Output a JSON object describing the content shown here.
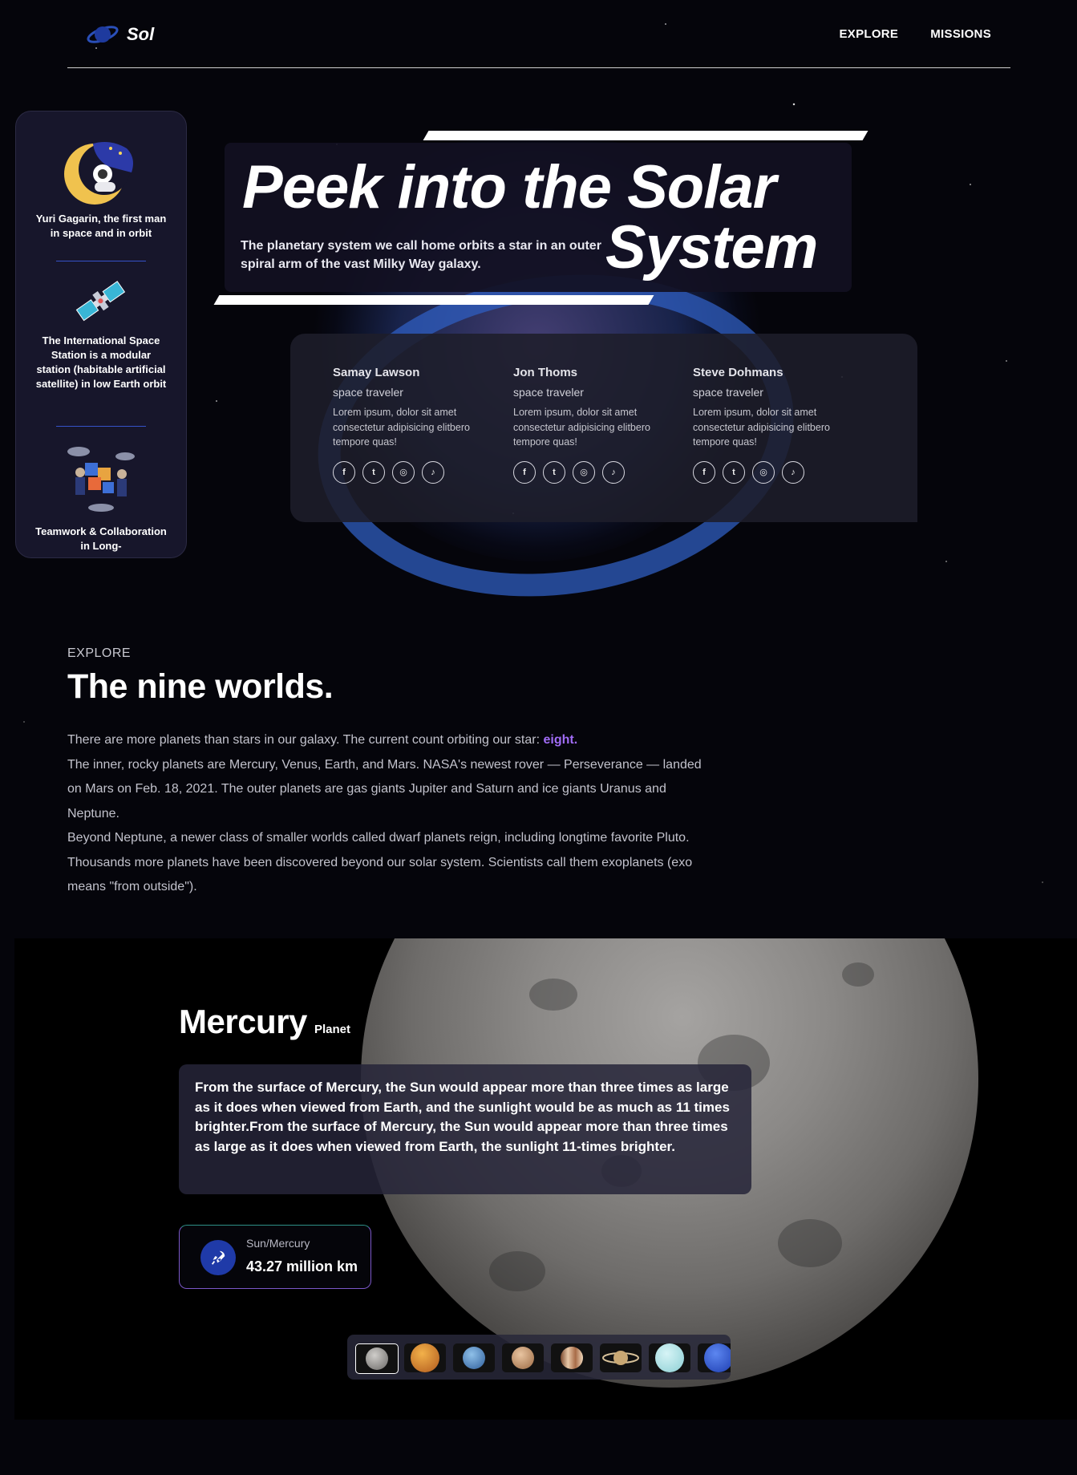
{
  "brand": {
    "name": "Sol"
  },
  "nav": {
    "links": [
      "EXPLORE",
      "MISSIONS"
    ]
  },
  "sidebar": {
    "items": [
      {
        "caption": "Yuri Gagarin, the first man in space and in orbit",
        "icon": "astronaut-moon-icon"
      },
      {
        "caption": "The International Space Station is a modular station (habitable artificial satellite) in low Earth orbit",
        "icon": "satellite-icon"
      },
      {
        "caption": "Teamwork & Collaboration in Long-",
        "icon": "teamwork-icon"
      }
    ]
  },
  "hero": {
    "title_line1": "Peek into the Solar",
    "title_line2": "System",
    "subtitle": "The planetary system we call home orbits a star in an outer spiral arm of the vast Milky Way galaxy."
  },
  "team": [
    {
      "name": "Samay Lawson",
      "role": "space traveler",
      "desc": "Lorem ipsum, dolor sit amet consectetur adipisicing elitbero tempore quas!"
    },
    {
      "name": "Jon Thoms",
      "role": "space traveler",
      "desc": "Lorem ipsum, dolor sit amet consectetur adipisicing elitbero tempore quas!"
    },
    {
      "name": "Steve Dohmans",
      "role": "space traveler",
      "desc": "Lorem ipsum, dolor sit amet consectetur adipisicing elitbero tempore quas!"
    }
  ],
  "social_icons": [
    "facebook-icon",
    "twitter-icon",
    "instagram-icon",
    "tiktok-icon"
  ],
  "social_glyphs": [
    "f",
    "t",
    "◎",
    "♪"
  ],
  "explore": {
    "label": "EXPLORE",
    "title": "The nine worlds.",
    "p1_prefix": "There are more planets than stars in our galaxy. The current count orbiting our star:",
    "p1_accent": "eight.",
    "p2": "The inner, rocky planets are Mercury, Venus, Earth, and Mars. NASA's newest rover — Perseverance — landed on Mars on Feb. 18, 2021. The outer planets are gas giants Jupiter and Saturn and ice giants Uranus and Neptune.",
    "p3": "Beyond Neptune, a newer class of smaller worlds called dwarf planets reign, including longtime favorite Pluto. Thousands more planets have been discovered beyond our solar system. Scientists call them exoplanets (exo means \"from outside\")."
  },
  "planet": {
    "name": "Mercury",
    "tag": "Planet",
    "description": "From the surface of Mercury, the Sun would appear more than three times as large as it does when viewed from Earth, and the sunlight would be as much as 11 times brighter.From the surface of Mercury, the Sun would appear more than three times as large as it does when viewed from Earth, the sunlight 11-times brighter.",
    "distance_label": "Sun/Mercury",
    "distance_value": "43.27 million km"
  },
  "thumbnails": [
    "mercury",
    "venus",
    "earth",
    "mars",
    "jupiter",
    "saturn",
    "uranus",
    "neptune"
  ],
  "colors": {
    "accent": "#a06cf5",
    "panel": "#17162b",
    "icon_bg": "#1f3aa8"
  }
}
